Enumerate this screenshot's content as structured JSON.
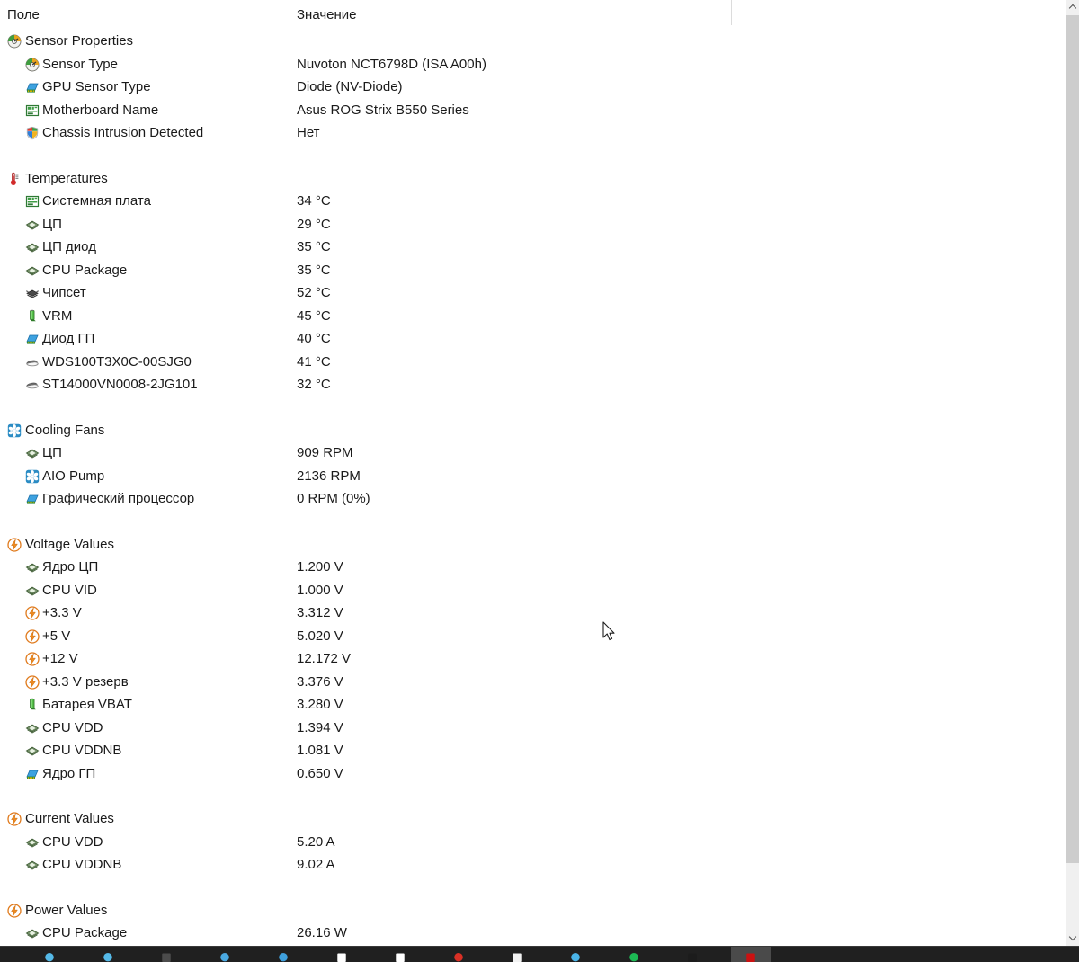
{
  "window": {
    "columns": {
      "field": "Поле",
      "value": "Значение"
    }
  },
  "sections": [
    {
      "title": "Sensor Properties",
      "icon": "sensor-gauge-icon",
      "rows": [
        {
          "label": "Sensor Type",
          "value": "Nuvoton NCT6798D  (ISA A00h)",
          "icon": "sensor-gauge-icon"
        },
        {
          "label": "GPU Sensor Type",
          "value": "Diode  (NV-Diode)",
          "icon": "gpu-card-icon"
        },
        {
          "label": "Motherboard Name",
          "value": "Asus ROG Strix B550 Series",
          "icon": "motherboard-icon"
        },
        {
          "label": "Chassis Intrusion Detected",
          "value": "Нет",
          "icon": "shield-icon"
        }
      ]
    },
    {
      "title": "Temperatures",
      "icon": "thermometer-icon",
      "rows": [
        {
          "label": "Системная плата",
          "value": "34 °C",
          "icon": "motherboard-icon"
        },
        {
          "label": "ЦП",
          "value": "29 °C",
          "icon": "cpu-chip-icon"
        },
        {
          "label": "ЦП диод",
          "value": "35 °C",
          "icon": "cpu-chip-icon"
        },
        {
          "label": "CPU Package",
          "value": "35 °C",
          "icon": "cpu-chip-icon"
        },
        {
          "label": "Чипсет",
          "value": "52 °C",
          "icon": "chipset-icon"
        },
        {
          "label": "VRM",
          "value": "45 °C",
          "icon": "vrm-icon"
        },
        {
          "label": "Диод ГП",
          "value": "40 °C",
          "icon": "gpu-card-icon"
        },
        {
          "label": "WDS100T3X0C-00SJG0",
          "value": "41 °C",
          "icon": "drive-icon"
        },
        {
          "label": "ST14000VN0008-2JG101",
          "value": "32 °C",
          "icon": "drive-icon"
        }
      ]
    },
    {
      "title": "Cooling Fans",
      "icon": "fan-icon",
      "rows": [
        {
          "label": "ЦП",
          "value": "909 RPM",
          "icon": "cpu-chip-icon"
        },
        {
          "label": "AIO Pump",
          "value": "2136 RPM",
          "icon": "fan-icon"
        },
        {
          "label": "Графический процессор",
          "value": "0 RPM  (0%)",
          "icon": "gpu-card-icon"
        }
      ]
    },
    {
      "title": "Voltage Values",
      "icon": "bolt-icon",
      "rows": [
        {
          "label": "Ядро ЦП",
          "value": "1.200 V",
          "icon": "cpu-chip-icon"
        },
        {
          "label": "CPU VID",
          "value": "1.000 V",
          "icon": "cpu-chip-icon"
        },
        {
          "label": "+3.3 V",
          "value": "3.312 V",
          "icon": "bolt-icon"
        },
        {
          "label": "+5 V",
          "value": "5.020 V",
          "icon": "bolt-icon"
        },
        {
          "label": "+12 V",
          "value": "12.172 V",
          "icon": "bolt-icon"
        },
        {
          "label": "+3.3 V резерв",
          "value": "3.376 V",
          "icon": "bolt-icon"
        },
        {
          "label": "Батарея VBAT",
          "value": "3.280 V",
          "icon": "vrm-icon"
        },
        {
          "label": "CPU VDD",
          "value": "1.394 V",
          "icon": "cpu-chip-icon"
        },
        {
          "label": "CPU VDDNB",
          "value": "1.081 V",
          "icon": "cpu-chip-icon"
        },
        {
          "label": "Ядро ГП",
          "value": "0.650 V",
          "icon": "gpu-card-icon"
        }
      ]
    },
    {
      "title": "Current Values",
      "icon": "bolt-icon",
      "rows": [
        {
          "label": "CPU VDD",
          "value": "5.20 A",
          "icon": "cpu-chip-icon"
        },
        {
          "label": "CPU VDDNB",
          "value": "9.02 A",
          "icon": "cpu-chip-icon"
        }
      ]
    },
    {
      "title": "Power Values",
      "icon": "bolt-icon",
      "rows": [
        {
          "label": "CPU Package",
          "value": "26.16 W",
          "icon": "cpu-chip-icon"
        }
      ]
    }
  ],
  "scrollbar": {
    "up_arrow": "scroll-up-arrow",
    "down_arrow": "scroll-down-arrow"
  },
  "taskbar": {
    "items": [
      {
        "name": "taskbar-icon-1",
        "icon": "blue-globe-icon",
        "color": "#55b9e8",
        "active": false
      },
      {
        "name": "taskbar-icon-2",
        "icon": "blue-globe-icon",
        "color": "#55b9e8",
        "active": false
      },
      {
        "name": "taskbar-icon-3",
        "icon": "dark-app-icon",
        "color": "#4c4c4c",
        "active": false
      },
      {
        "name": "taskbar-icon-4",
        "icon": "blue-globe-icon",
        "color": "#4aa8e0",
        "active": false
      },
      {
        "name": "taskbar-icon-5",
        "icon": "blue-globe-icon",
        "color": "#3fa0dd",
        "active": false
      },
      {
        "name": "taskbar-icon-6",
        "icon": "white-black-app-icon",
        "color": "#ffffff",
        "active": false
      },
      {
        "name": "taskbar-icon-7",
        "icon": "white-doc-icon",
        "color": "#ffffff",
        "active": false
      },
      {
        "name": "taskbar-icon-8",
        "icon": "chrome-icon",
        "color": "#d93025",
        "active": false
      },
      {
        "name": "taskbar-icon-9",
        "icon": "white-pin-icon",
        "color": "#f2f2f2",
        "active": false
      },
      {
        "name": "taskbar-icon-10",
        "icon": "blue-circle-icon",
        "color": "#4ab4e8",
        "active": false
      },
      {
        "name": "taskbar-icon-11",
        "icon": "spotify-icon",
        "color": "#1db954",
        "active": false
      },
      {
        "name": "taskbar-icon-12",
        "icon": "dark-app-icon",
        "color": "#1c1c1c",
        "active": false
      },
      {
        "name": "taskbar-icon-13",
        "icon": "red-app-icon",
        "color": "#cc1111",
        "active": true
      }
    ]
  },
  "cursor": {
    "icon": "mouse-arrow-cursor"
  }
}
